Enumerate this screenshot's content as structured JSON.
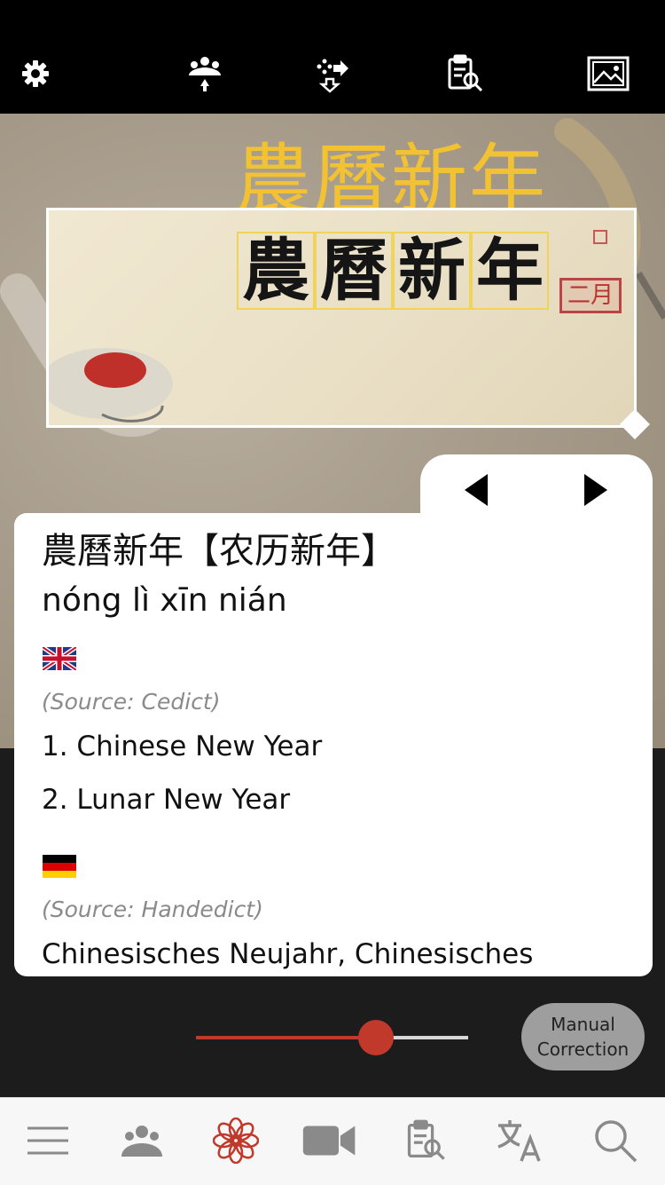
{
  "toolbar": {
    "icons": [
      "gear-icon",
      "group-share-icon",
      "drag-drop-icon",
      "clipboard-search-icon",
      "image-icon"
    ]
  },
  "recognized_title": "農曆新年",
  "crop": {
    "chars": [
      "農",
      "曆",
      "新",
      "年"
    ],
    "seal_text": "二月"
  },
  "entry": {
    "headword": "農曆新年【农历新年】",
    "pinyin": "nóng lì xīn nián",
    "sections": [
      {
        "flag": "uk-flag",
        "source": "(Source: Cedict)",
        "definitions": [
          "1. Chinese New Year",
          "2. Lunar New Year"
        ]
      },
      {
        "flag": "german-flag",
        "source": "(Source: Handedict)",
        "definitions": [
          "Chinesisches Neujahr, Chinesisches"
        ]
      }
    ]
  },
  "slider": {
    "value": 0.6
  },
  "manual_correction": {
    "line1": "Manual",
    "line2": "Correction"
  },
  "colors": {
    "accent": "#c0392b",
    "title": "#f2c233"
  },
  "bottom_nav": [
    "menu-icon",
    "people-icon",
    "flower-icon",
    "video-icon",
    "clipboard-search-icon",
    "translate-icon",
    "search-icon"
  ]
}
